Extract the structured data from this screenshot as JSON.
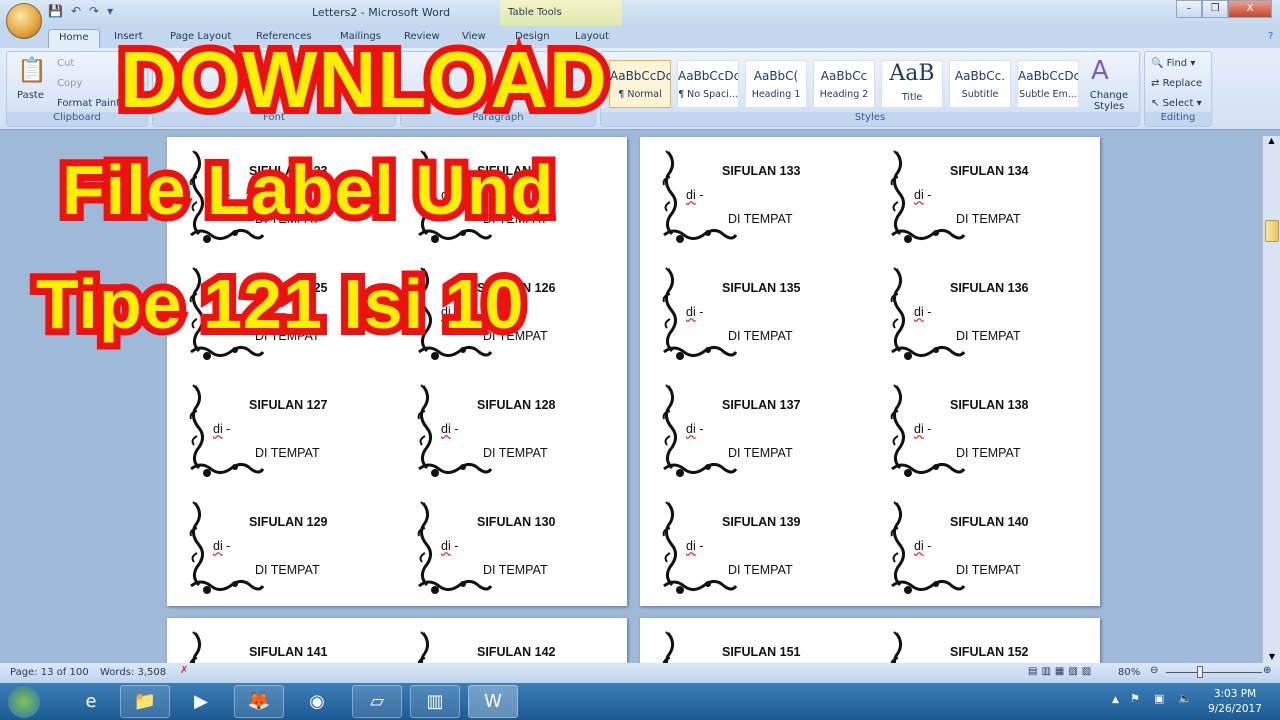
{
  "window": {
    "title": "Letters2 - Microsoft Word",
    "context_tab": "Table Tools",
    "minimize": "–",
    "restore": "❐",
    "close": "X"
  },
  "tabs": [
    "Home",
    "Insert",
    "Page Layout",
    "References",
    "Mailings",
    "Review",
    "View",
    "Design",
    "Layout"
  ],
  "ribbon": {
    "clipboard": {
      "label": "Clipboard",
      "paste": "Paste",
      "cut": "Cut",
      "copy": "Copy",
      "format_painter": "Format Painter"
    },
    "font": {
      "label": "Font"
    },
    "paragraph": {
      "label": "Paragraph"
    },
    "styles": {
      "label": "Styles",
      "items": [
        {
          "preview": "AaBbCcDc",
          "name": "¶ Normal"
        },
        {
          "preview": "AaBbCcDc",
          "name": "¶ No Spaci..."
        },
        {
          "preview": "AaBbC(",
          "name": "Heading 1"
        },
        {
          "preview": "AaBbCc",
          "name": "Heading 2"
        },
        {
          "preview": "AaB",
          "name": "Title"
        },
        {
          "preview": "AaBbCc.",
          "name": "Subtitle"
        },
        {
          "preview": "AaBbCcDc",
          "name": "Subtle Em..."
        }
      ],
      "change_styles": "Change Styles"
    },
    "editing": {
      "label": "Editing",
      "find": "Find",
      "replace": "Replace",
      "select": "Select"
    }
  },
  "document": {
    "di": "di",
    "dash": " -",
    "tempat": "DI TEMPAT",
    "pages": [
      {
        "labels": [
          "SIFULAN 123",
          "SIFULAN 124",
          "SIFULAN 125",
          "SIFULAN 126",
          "SIFULAN 127",
          "SIFULAN 128",
          "SIFULAN 129",
          "SIFULAN 130"
        ]
      },
      {
        "labels": [
          "SIFULAN 133",
          "SIFULAN 134",
          "SIFULAN 135",
          "SIFULAN 136",
          "SIFULAN 137",
          "SIFULAN 138",
          "SIFULAN 139",
          "SIFULAN 140"
        ]
      },
      {
        "labels": [
          "SIFULAN 141",
          "SIFULAN 142"
        ]
      },
      {
        "labels": [
          "SIFULAN 151",
          "SIFULAN 152"
        ]
      }
    ]
  },
  "overlay": {
    "line1": "DOWNLOAD",
    "line2": "File Label Und",
    "line3": "Tipe 121 Isi 10",
    "text_color": "#ffef00",
    "stroke_color": "#ee1111"
  },
  "status": {
    "page": "Page: 13 of 100",
    "words": "Words: 3,508",
    "zoom": "80%"
  },
  "taskbar": {
    "time": "3:03 PM",
    "date": "9/26/2017"
  }
}
